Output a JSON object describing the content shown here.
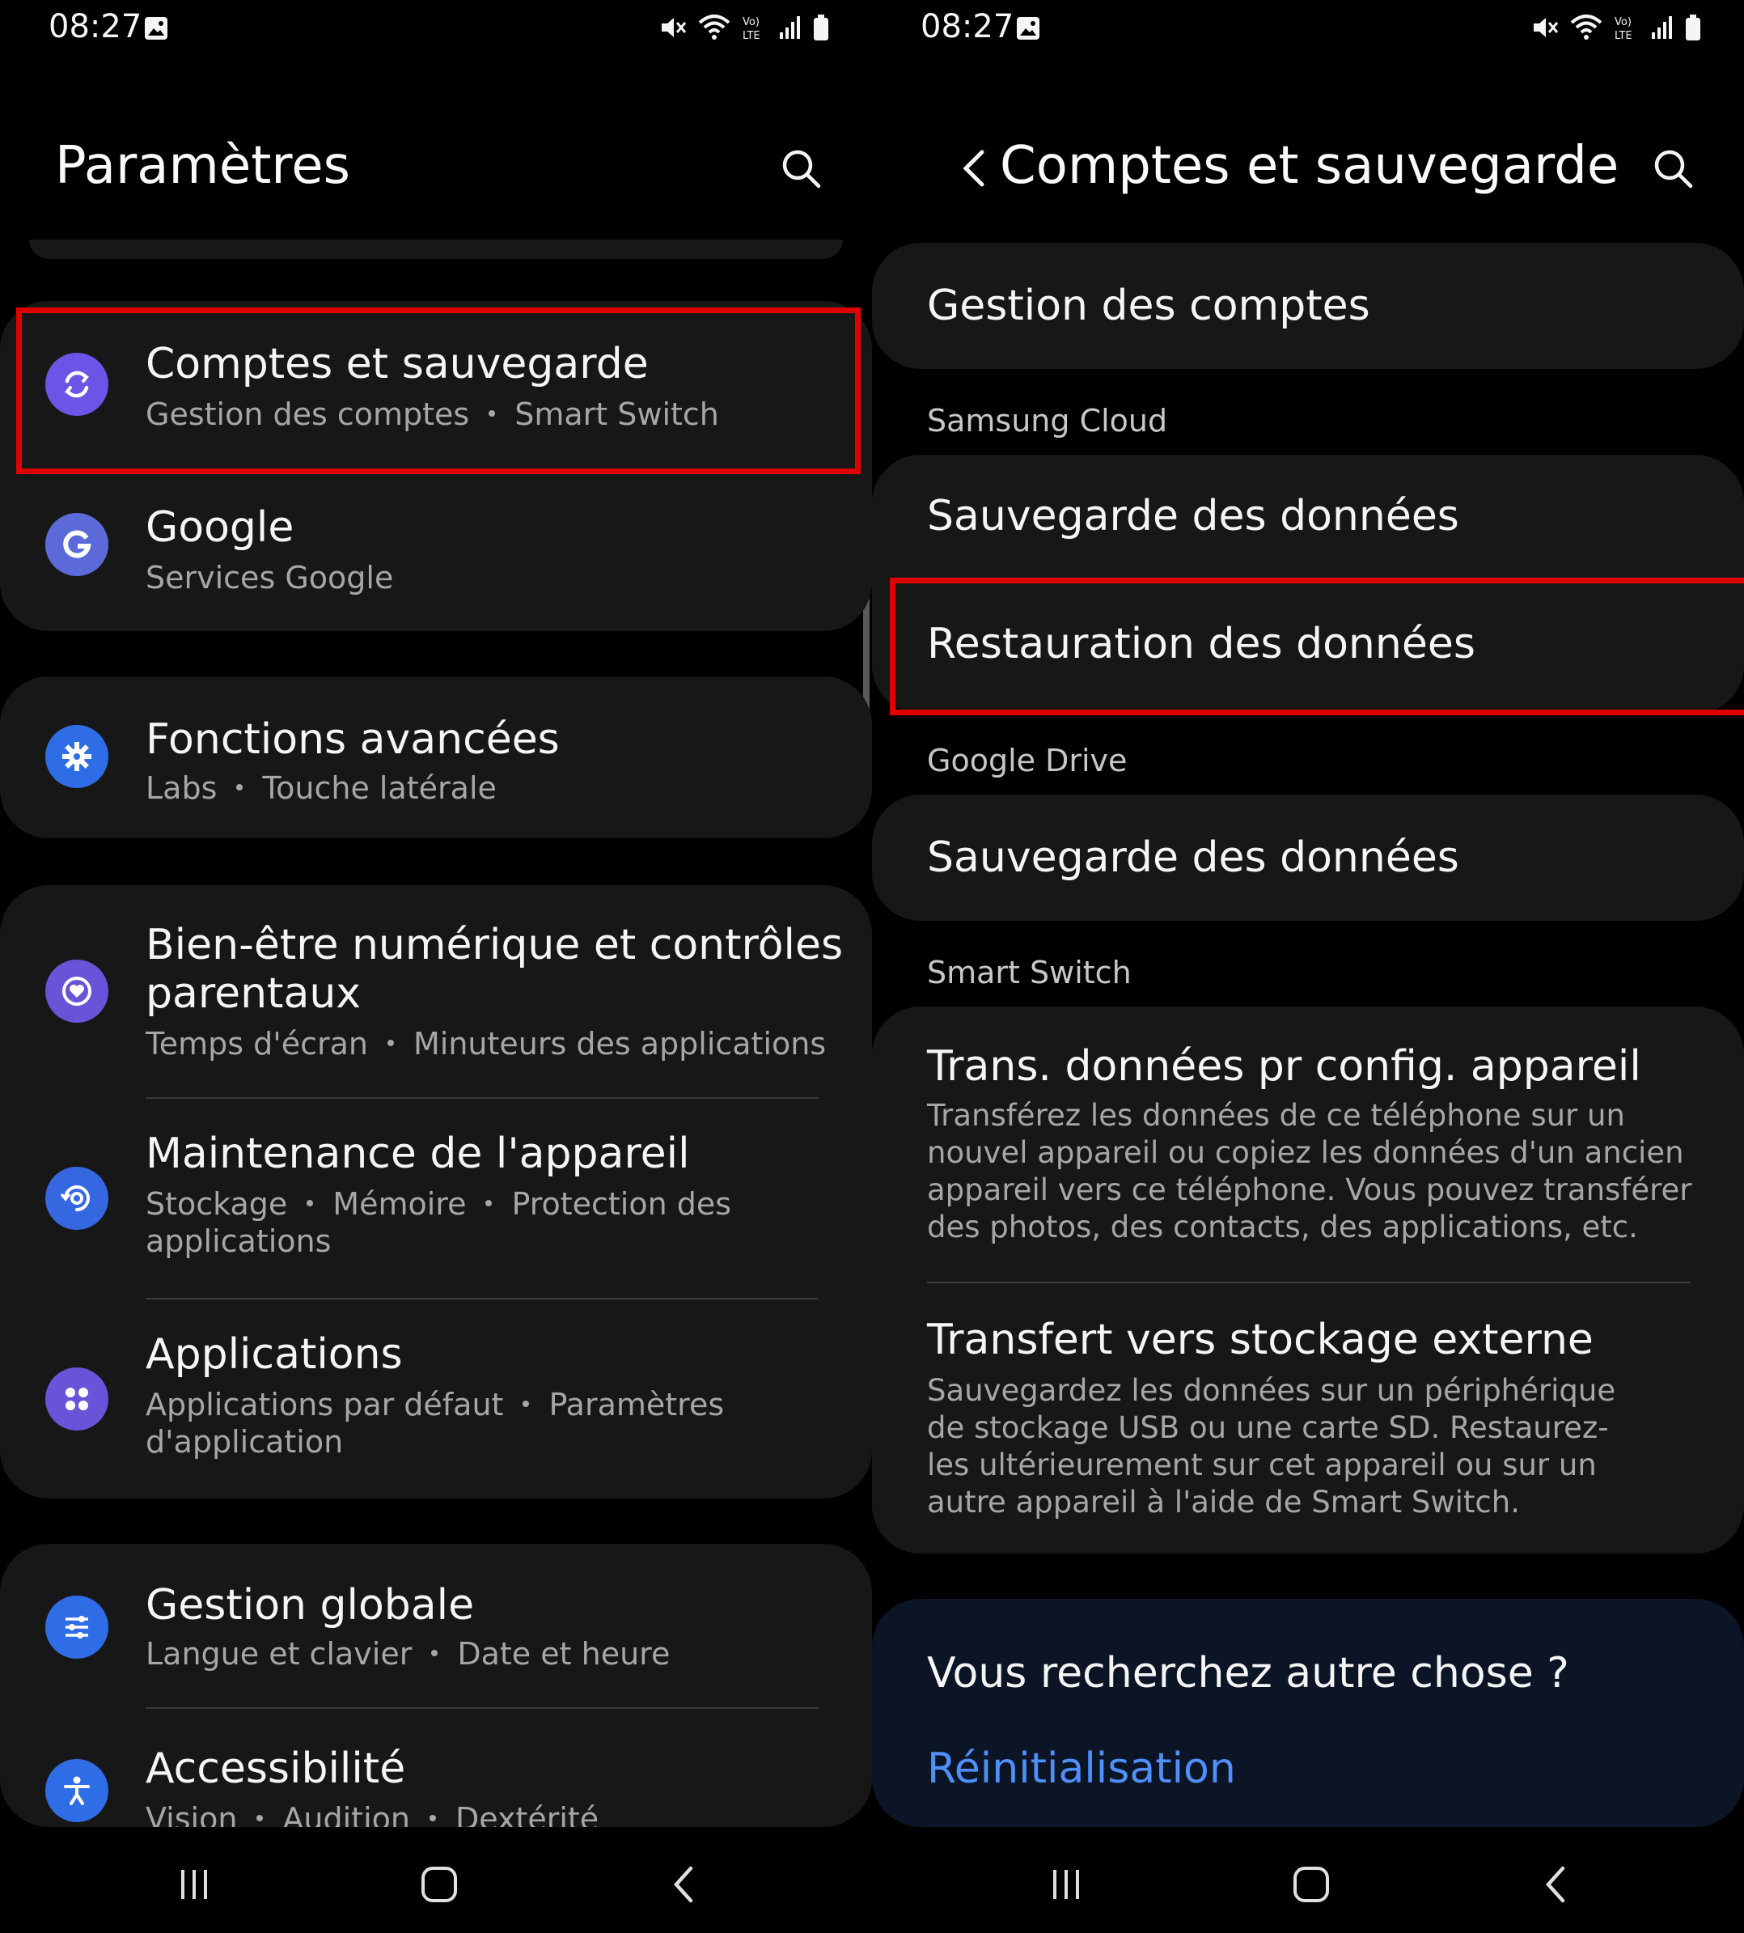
{
  "status_bar": {
    "time": "08:27",
    "icons": [
      "image-icon",
      "mute-icon",
      "wifi-icon",
      "volte-icon",
      "signal-icon",
      "battery-icon"
    ]
  },
  "left": {
    "title": "Paramètres",
    "items": [
      {
        "title": "Comptes et sauvegarde",
        "subs": [
          "Gestion des comptes",
          "Smart Switch"
        ],
        "icon": "sync-icon",
        "color": "#6b55e6"
      },
      {
        "title": "Google",
        "subs": [
          "Services Google"
        ],
        "icon": "google-icon",
        "color": "#5b6ad8"
      },
      {
        "title": "Fonctions avancées",
        "subs": [
          "Labs",
          "Touche latérale"
        ],
        "icon": "puzzle-gear-icon",
        "color": "#2f6de6"
      },
      {
        "title": "Bien-être numérique et contrôles",
        "title2": "parentaux",
        "subs": [
          "Temps d'écran",
          "Minuteurs des applications"
        ],
        "icon": "heart-circle-icon",
        "color": "#6a52d9"
      },
      {
        "title": "Maintenance de l'appareil",
        "subs": [
          "Stockage",
          "Mémoire",
          "Protection des"
        ],
        "sub2": "applications",
        "icon": "maintenance-icon",
        "color": "#3567e0"
      },
      {
        "title": "Applications",
        "subs": [
          "Applications par défaut",
          "Paramètres"
        ],
        "sub2": "d'application",
        "icon": "apps-grid-icon",
        "color": "#6a52d9"
      },
      {
        "title": "Gestion globale",
        "subs": [
          "Langue et clavier",
          "Date et heure"
        ],
        "icon": "sliders-icon",
        "color": "#2f6de6"
      },
      {
        "title": "Accessibilité",
        "subs": [
          "Vision",
          "Audition",
          "Dextérité"
        ],
        "icon": "accessibility-icon",
        "color": "#2f6de6"
      }
    ]
  },
  "right": {
    "title": "Comptes et sauvegarde",
    "account_mgmt": "Gestion des comptes",
    "samsung_cloud_label": "Samsung Cloud",
    "sc_backup": "Sauvegarde des données",
    "sc_restore": "Restauration des données",
    "google_drive_label": "Google Drive",
    "gd_backup": "Sauvegarde des données",
    "smart_switch_label": "Smart Switch",
    "transfer_title": "Trans. données pr config. appareil",
    "transfer_desc": "Transférez les données de ce téléphone sur un nouvel appareil ou copiez les données d'un ancien appareil vers ce téléphone. Vous pouvez transférer des photos, des contacts, des applications, etc.",
    "external_title": "Transfert vers stockage externe",
    "external_desc": "Sauvegardez les données sur un périphérique de stockage USB ou une carte SD. Restaurez-les ultérieurement sur cet appareil ou sur un autre appareil à l'aide de Smart Switch.",
    "looking_title": "Vous recherchez autre chose ?",
    "looking_link": "Réinitialisation"
  },
  "colors": {
    "highlight": "#e00000",
    "link": "#4f8ff7",
    "card": "#171717",
    "looking_card": "#0b1526"
  }
}
